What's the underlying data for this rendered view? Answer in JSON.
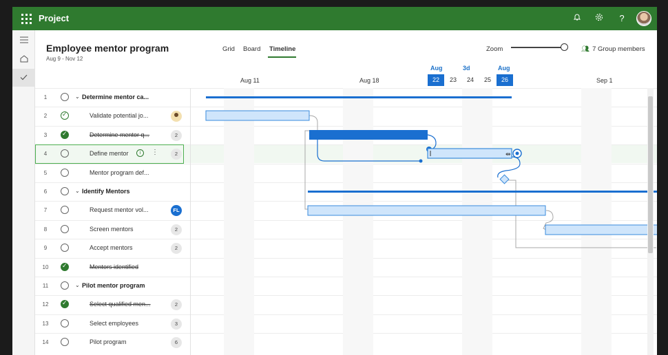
{
  "topbar": {
    "app_name": "Project",
    "icons": [
      "waffle-icon",
      "bell-icon",
      "settings-icon",
      "help-icon",
      "user-avatar"
    ],
    "help_glyph": "?"
  },
  "rail": {
    "icons": [
      "hamburger-icon",
      "home-icon",
      "check-icon"
    ]
  },
  "plan": {
    "title": "Employee mentor program",
    "dates": "Aug 9 - Nov 12"
  },
  "views": {
    "grid": "Grid",
    "board": "Board",
    "timeline": "Timeline",
    "active": "Timeline"
  },
  "zoom": {
    "label": "Zoom",
    "level": 1.0
  },
  "members": {
    "label": "7 Group members"
  },
  "timeline": {
    "weeks": [
      "Aug 11",
      "Aug 18",
      "Sep 1"
    ],
    "selected_span": {
      "start_month": "Aug",
      "duration": "3d",
      "end_month": "Aug"
    },
    "days": [
      "22",
      "23",
      "24",
      "25",
      "26"
    ],
    "selected_days": [
      "22",
      "26"
    ]
  },
  "tasks": [
    {
      "num": "1",
      "name": "Determine mentor ca...",
      "summary": true,
      "status": "open",
      "badge": ""
    },
    {
      "num": "2",
      "name": "Validate potential jo...",
      "summary": false,
      "status": "hint",
      "badge": "person"
    },
    {
      "num": "3",
      "name": "Determine mentor q...",
      "summary": false,
      "status": "done",
      "badge": "2"
    },
    {
      "num": "4",
      "name": "Define mentor",
      "summary": false,
      "status": "open",
      "badge": "2",
      "selected": true
    },
    {
      "num": "5",
      "name": "Mentor program def...",
      "summary": false,
      "status": "open",
      "badge": ""
    },
    {
      "num": "6",
      "name": "Identify Mentors",
      "summary": true,
      "status": "open",
      "badge": ""
    },
    {
      "num": "7",
      "name": "Request mentor vol...",
      "summary": false,
      "status": "open",
      "badge": "FL"
    },
    {
      "num": "8",
      "name": "Screen mentors",
      "summary": false,
      "status": "open",
      "badge": "2"
    },
    {
      "num": "9",
      "name": "Accept mentors",
      "summary": false,
      "status": "open",
      "badge": "2"
    },
    {
      "num": "10",
      "name": "Mentors identified",
      "summary": false,
      "status": "done",
      "badge": ""
    },
    {
      "num": "11",
      "name": "Pilot mentor program",
      "summary": true,
      "status": "open",
      "badge": ""
    },
    {
      "num": "12",
      "name": "Select qualified men...",
      "summary": false,
      "status": "done",
      "badge": "2"
    },
    {
      "num": "13",
      "name": "Select employees",
      "summary": false,
      "status": "open",
      "badge": "3"
    },
    {
      "num": "14",
      "name": "Pilot program",
      "summary": false,
      "status": "open",
      "badge": "6"
    }
  ],
  "colors": {
    "brand": "#2f7a2f",
    "bar_dark": "#1a6fd0",
    "bar_light": "#cfe5fb",
    "bar_light_border": "#3a8bdc",
    "connector": "#a8a8a8"
  }
}
